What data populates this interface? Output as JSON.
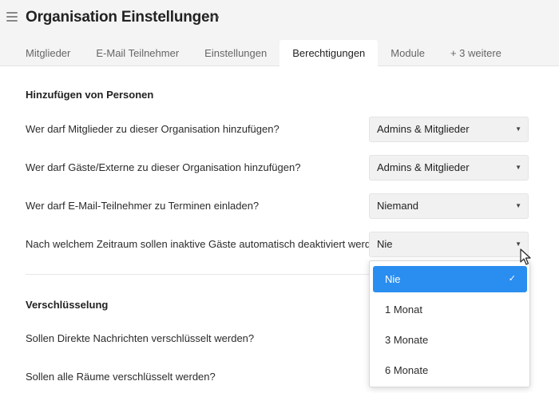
{
  "header": {
    "title": "Organisation Einstellungen",
    "more": "···"
  },
  "tabs": [
    {
      "label": "Mitglieder",
      "active": false
    },
    {
      "label": "E-Mail Teilnehmer",
      "active": false
    },
    {
      "label": "Einstellungen",
      "active": false
    },
    {
      "label": "Berechtigungen",
      "active": true
    },
    {
      "label": "Module",
      "active": false
    },
    {
      "label": "+ 3 weitere",
      "active": false
    }
  ],
  "sections": {
    "add_people": {
      "title": "Hinzufügen von Personen",
      "rows": [
        {
          "question": "Wer darf Mitglieder zu dieser Organisation hinzufügen?",
          "value": "Admins & Mitglieder"
        },
        {
          "question": "Wer darf Gäste/Externe zu dieser Organisation hinzufügen?",
          "value": "Admins & Mitglieder"
        },
        {
          "question": "Wer darf E-Mail-Teilnehmer zu Terminen einladen?",
          "value": "Niemand"
        },
        {
          "question": "Nach welchem Zeitraum sollen inaktive Gäste automatisch deaktiviert werden?",
          "value": "Nie"
        }
      ]
    },
    "encryption": {
      "title": "Verschlüsselung",
      "rows": [
        {
          "question": "Sollen Direkte Nachrichten verschlüsselt werden?"
        },
        {
          "question": "Sollen alle Räume verschlüsselt werden?"
        }
      ]
    }
  },
  "dropdown": {
    "selected": "Nie",
    "options": [
      "Nie",
      "1 Monat",
      "3 Monate",
      "6 Monate"
    ]
  },
  "colors": {
    "accent": "#2a8ef0",
    "header_bg": "#f4f4f4"
  }
}
